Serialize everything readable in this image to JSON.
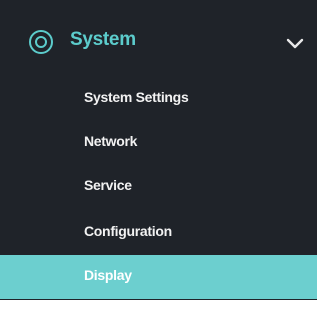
{
  "sidebar": {
    "section": {
      "title": "System",
      "icon": "settings-ring-icon",
      "expanded": true,
      "expand_icon": "chevron-down-icon"
    },
    "items": [
      {
        "label": "System Settings",
        "active": false
      },
      {
        "label": "Network",
        "active": false
      },
      {
        "label": "Service",
        "active": false
      },
      {
        "label": "Configuration",
        "active": false
      },
      {
        "label": "Display",
        "active": true
      }
    ],
    "next_item_partial": ""
  },
  "colors": {
    "sidebar_bg": "#1f2329",
    "accent": "#5ccccc",
    "active_bg": "#6ccfcf",
    "text": "#f2f2f2"
  }
}
